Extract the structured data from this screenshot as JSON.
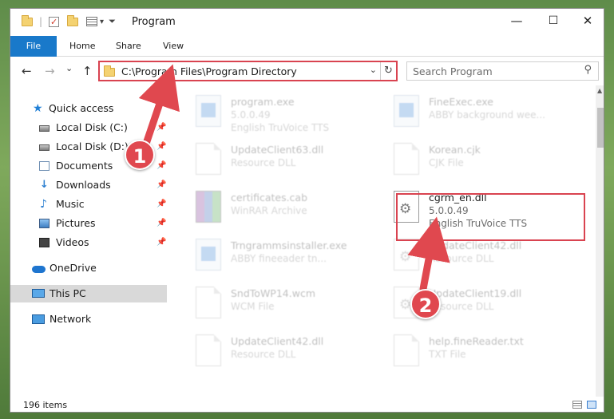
{
  "window": {
    "title": "Program",
    "min_glyph": "—",
    "max_glyph": "☐",
    "close_glyph": "✕",
    "qa_dropdown_glyph": "▾",
    "qa_sep": "|"
  },
  "ribbon": {
    "tabs": [
      {
        "label": "File"
      },
      {
        "label": "Home"
      },
      {
        "label": "Share"
      },
      {
        "label": "View"
      }
    ]
  },
  "nav": {
    "back_glyph": "←",
    "forward_glyph": "→",
    "recent_glyph": "⌄",
    "up_glyph": "↑"
  },
  "address": {
    "path": "C:\\Program Files\\Program Directory",
    "chevron_glyph": "⌄",
    "refresh_glyph": "↻"
  },
  "search": {
    "placeholder": "Search Program",
    "icon_glyph": "⚲"
  },
  "sidebar": {
    "pin_glyph": "📌",
    "items": [
      {
        "label": "Quick access",
        "icon": "star-icon",
        "glyph": "★"
      },
      {
        "label": "Local Disk (C:)",
        "icon": "disk-icon"
      },
      {
        "label": "Local Disk (D:)",
        "icon": "disk-icon"
      },
      {
        "label": "Documents",
        "icon": "documents-icon"
      },
      {
        "label": "Downloads",
        "icon": "download-icon",
        "glyph": "↓"
      },
      {
        "label": "Music",
        "icon": "music-icon",
        "glyph": "♪"
      },
      {
        "label": "Pictures",
        "icon": "pictures-icon"
      },
      {
        "label": "Videos",
        "icon": "videos-icon"
      },
      {
        "label": "OneDrive",
        "icon": "cloud-icon"
      },
      {
        "label": "This PC",
        "icon": "computer-icon",
        "selected": true
      },
      {
        "label": "Network",
        "icon": "network-icon"
      }
    ]
  },
  "files": [
    {
      "name": "program.exe",
      "line1": "5.0.0.49",
      "line2": "English TruVoice TTS",
      "icon": "exe-icon",
      "faded": true
    },
    {
      "name": "FineExec.exe",
      "line1": "ABBY background wee...",
      "line2": "",
      "icon": "exe-icon",
      "faded": true
    },
    {
      "name": "UpdateClient63.dll",
      "line1": "Resource DLL",
      "line2": "",
      "icon": "document-icon",
      "faded": true
    },
    {
      "name": "Korean.cjk",
      "line1": "CJK File",
      "line2": "",
      "icon": "document-icon",
      "faded": true
    },
    {
      "name": "certificates.cab",
      "line1": "WinRAR Archive",
      "line2": "",
      "icon": "archive-icon",
      "faded": true
    },
    {
      "name": "cgrm_en.dll",
      "line1": "5.0.0.49",
      "line2": "English TruVoice TTS",
      "icon": "gear-document-icon",
      "faded": false
    },
    {
      "name": "Trngrammsinstaller.exe",
      "line1": "ABBY fineeader tn...",
      "line2": "",
      "icon": "exe-icon",
      "faded": true
    },
    {
      "name": "UpdateClient42.dll",
      "line1": "Resource DLL",
      "line2": "",
      "icon": "gear-document-icon",
      "faded": true
    },
    {
      "name": "SndToWP14.wcm",
      "line1": "WCM File",
      "line2": "",
      "icon": "document-icon",
      "faded": true
    },
    {
      "name": "UpdateClient19.dll",
      "line1": "Resource DLL",
      "line2": "",
      "icon": "gear-document-icon",
      "faded": true
    },
    {
      "name": "UpdateClient42.dll",
      "line1": "Resource DLL",
      "line2": "",
      "icon": "document-icon",
      "faded": true
    },
    {
      "name": "help.fineReader.txt",
      "line1": "TXT File",
      "line2": "",
      "icon": "document-icon",
      "faded": true
    }
  ],
  "status": {
    "item_count": "196 items"
  },
  "annotations": {
    "step1": "1",
    "step2": "2",
    "color": "#e0484f"
  },
  "colors": {
    "accent": "#1979ca",
    "highlight": "#d94350",
    "selected_row": "#d9d9d9"
  }
}
